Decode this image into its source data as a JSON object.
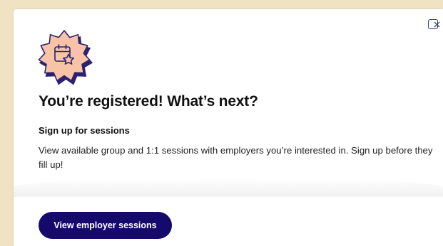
{
  "modal": {
    "close_label": "Close",
    "title": "You’re registered! What’s next?",
    "section_heading": "Sign up for sessions",
    "description": "View available group and 1:1 sessions with employers you’re interested in. Sign up before they fill up!",
    "cta_label": "View employer sessions",
    "badge_icon": "calendar-star-icon"
  },
  "colors": {
    "page_background": "#efe3c4",
    "badge_fill": "#f9c3a8",
    "badge_outline": "#2a2270",
    "button_background": "#150a6b",
    "close_outline": "#2d3a8c"
  }
}
